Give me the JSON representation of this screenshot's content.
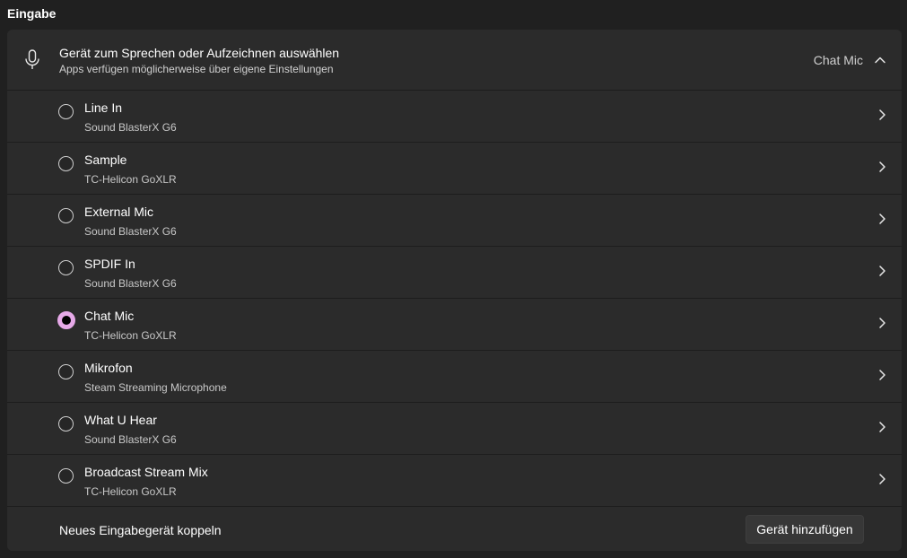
{
  "section": {
    "title": "Eingabe"
  },
  "header": {
    "title": "Gerät zum Sprechen oder Aufzeichnen auswählen",
    "subtitle": "Apps verfügen möglicherweise über eigene Einstellungen",
    "current_value": "Chat Mic",
    "icon": "microphone-icon"
  },
  "devices": [
    {
      "name": "Line In",
      "source": "Sound BlasterX G6",
      "selected": false
    },
    {
      "name": "Sample",
      "source": "TC-Helicon GoXLR",
      "selected": false
    },
    {
      "name": "External Mic",
      "source": "Sound BlasterX G6",
      "selected": false
    },
    {
      "name": "SPDIF In",
      "source": "Sound BlasterX G6",
      "selected": false
    },
    {
      "name": "Chat Mic",
      "source": "TC-Helicon GoXLR",
      "selected": true
    },
    {
      "name": "Mikrofon",
      "source": "Steam Streaming Microphone",
      "selected": false
    },
    {
      "name": "What U Hear",
      "source": "Sound BlasterX G6",
      "selected": false
    },
    {
      "name": "Broadcast Stream Mix",
      "source": "TC-Helicon GoXLR",
      "selected": false
    }
  ],
  "footer": {
    "label": "Neues Eingabegerät koppeln",
    "button_label": "Gerät hinzufügen"
  },
  "colors": {
    "accent": "#e6a9e8",
    "background": "#202020",
    "panel": "#2b2b2b"
  }
}
